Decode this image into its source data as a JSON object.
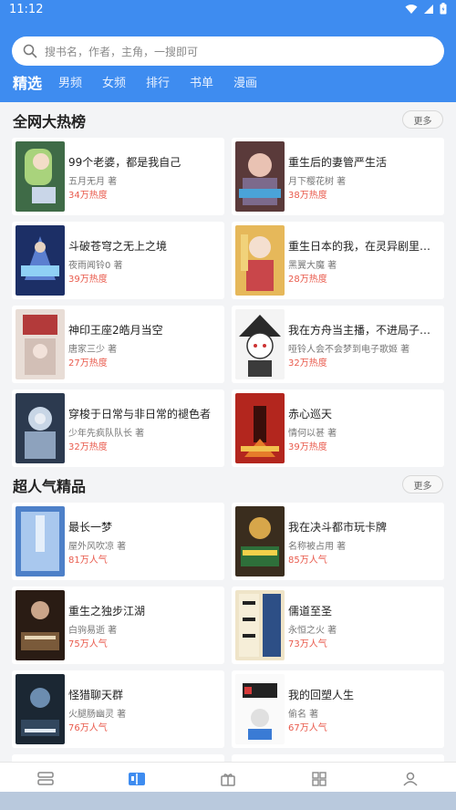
{
  "status_bar": {
    "time": "11:12"
  },
  "search": {
    "placeholder": "搜书名，作者，主角，一搜即可"
  },
  "tabs": [
    {
      "label": "精选",
      "active": true
    },
    {
      "label": "男频"
    },
    {
      "label": "女频"
    },
    {
      "label": "排行"
    },
    {
      "label": "书单"
    },
    {
      "label": "漫画"
    }
  ],
  "sections": [
    {
      "title": "全网大热榜",
      "more_label": "更多",
      "books": [
        {
          "title": "99个老婆，都是我自己",
          "author": "五月无月 著",
          "stat": "34万热度"
        },
        {
          "title": "重生后的妻管严生活",
          "author": "月下樱花树 著",
          "stat": "38万热度"
        },
        {
          "title": "斗破苍穹之无上之境",
          "author": "夜雨闻铃0 著",
          "stat": "39万热度"
        },
        {
          "title": "重生日本的我，在灵异剧里开...",
          "author": "黑翼大魔 著",
          "stat": "28万热度"
        },
        {
          "title": "神印王座2皓月当空",
          "author": "唐家三少 著",
          "stat": "27万热度"
        },
        {
          "title": "我在方舟当主播，不进局子就...",
          "author": "哑铃人会不会梦到电子歌姬 著",
          "stat": "32万热度"
        },
        {
          "title": "穿梭于日常与非日常的褪色者",
          "author": "少年先疯队队长 著",
          "stat": "32万热度"
        },
        {
          "title": "赤心巡天",
          "author": "情何以甚 著",
          "stat": "39万热度"
        }
      ]
    },
    {
      "title": "超人气精品",
      "more_label": "更多",
      "books": [
        {
          "title": "最长一梦",
          "author": "屋外风吹凉 著",
          "stat": "81万人气"
        },
        {
          "title": "我在决斗都市玩卡牌",
          "author": "名称被占用 著",
          "stat": "85万人气"
        },
        {
          "title": "重生之独步江湖",
          "author": "白驹易逝 著",
          "stat": "75万人气"
        },
        {
          "title": "儒道至圣",
          "author": "永恒之火 著",
          "stat": "73万人气"
        },
        {
          "title": "怪猎聊天群",
          "author": "火腿肠幽灵 著",
          "stat": "76万人气"
        },
        {
          "title": "我的回塑人生",
          "author": "偷名 著",
          "stat": "67万人气"
        }
      ]
    }
  ],
  "bottom_nav": [
    {
      "icon": "bookshelf-icon"
    },
    {
      "icon": "book-store-icon",
      "active": true
    },
    {
      "icon": "gift-icon"
    },
    {
      "icon": "category-grid-icon"
    },
    {
      "icon": "profile-icon"
    }
  ],
  "colors": {
    "brand": "#3e8cf0",
    "stat": "#e95a4c",
    "background": "#f3f4f6"
  }
}
